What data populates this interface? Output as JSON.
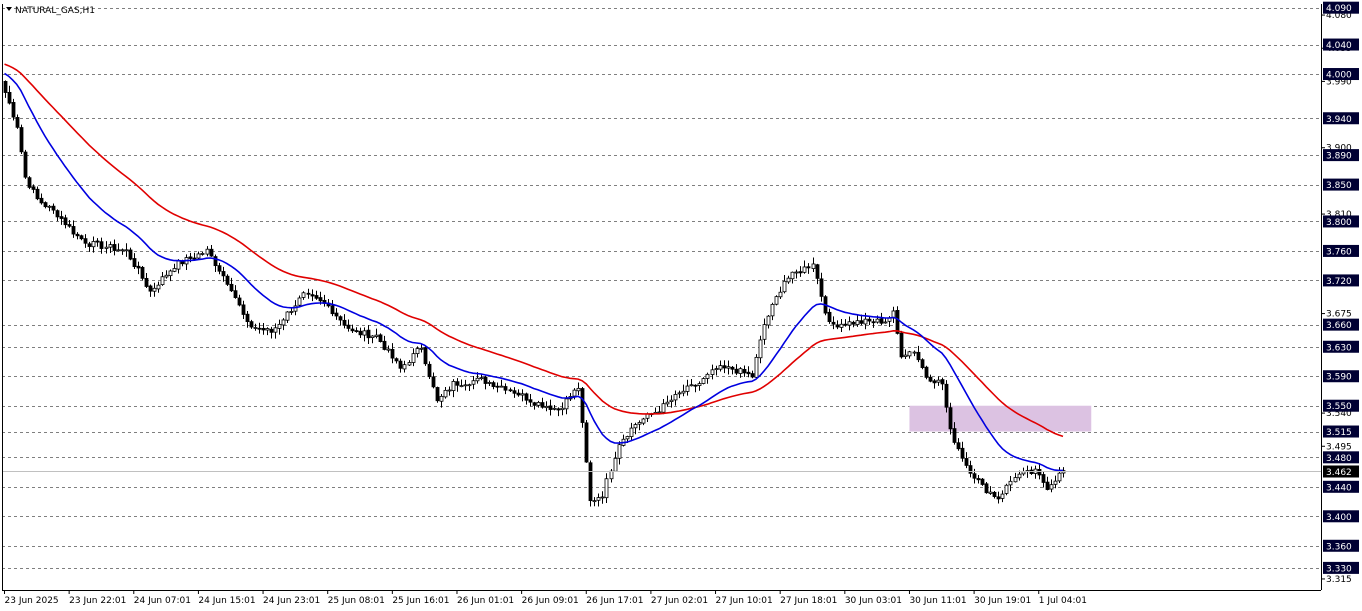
{
  "symbol_label": "NATURAL_GAS,H1",
  "current_price": "3.462",
  "colors": {
    "up": "#ffffff",
    "down": "#000000",
    "ema_fast": "#0000e0",
    "ema_slow": "#e00000",
    "zone": "#dcc2e2",
    "label_bg": "#000033"
  },
  "chart_data": {
    "type": "candlestick",
    "timeframe": "H1",
    "ylim": [
      3.3,
      4.095
    ],
    "y_label_levels": [
      4.09,
      4.04,
      4.0,
      3.94,
      3.89,
      3.85,
      3.8,
      3.76,
      3.72,
      3.66,
      3.63,
      3.59,
      3.55,
      3.515,
      3.48,
      3.44,
      3.4,
      3.36,
      3.33
    ],
    "y_minor_ticks": [
      4.08,
      4.035,
      3.99,
      3.9,
      3.81,
      3.675,
      3.54,
      3.495,
      3.315
    ],
    "x_ticks": [
      {
        "label": "23 Jun 2025",
        "bar": 0
      },
      {
        "label": "23 Jun 22:01",
        "bar": 16
      },
      {
        "label": "24 Jun 07:01",
        "bar": 32
      },
      {
        "label": "24 Jun 15:01",
        "bar": 48
      },
      {
        "label": "24 Jun 23:01",
        "bar": 64
      },
      {
        "label": "25 Jun 08:01",
        "bar": 80
      },
      {
        "label": "25 Jun 16:01",
        "bar": 96
      },
      {
        "label": "26 Jun 01:01",
        "bar": 112
      },
      {
        "label": "26 Jun 09:01",
        "bar": 128
      },
      {
        "label": "26 Jun 17:01",
        "bar": 144
      },
      {
        "label": "27 Jun 02:01",
        "bar": 160
      },
      {
        "label": "27 Jun 10:01",
        "bar": 176
      },
      {
        "label": "27 Jun 18:01",
        "bar": 192
      },
      {
        "label": "30 Jun 03:01",
        "bar": 208
      },
      {
        "label": "30 Jun 11:01",
        "bar": 224
      },
      {
        "label": "30 Jun 19:01",
        "bar": 240
      },
      {
        "label": "1 Jul 04:01",
        "bar": 256
      }
    ],
    "anchors": [
      [
        0,
        3.975
      ],
      [
        3,
        3.93
      ],
      [
        5,
        3.86
      ],
      [
        8,
        3.83
      ],
      [
        13,
        3.81
      ],
      [
        18,
        3.78
      ],
      [
        21,
        3.77
      ],
      [
        30,
        3.76
      ],
      [
        36,
        3.705
      ],
      [
        42,
        3.74
      ],
      [
        50,
        3.76
      ],
      [
        56,
        3.71
      ],
      [
        60,
        3.66
      ],
      [
        66,
        3.65
      ],
      [
        74,
        3.7
      ],
      [
        80,
        3.685
      ],
      [
        86,
        3.65
      ],
      [
        92,
        3.645
      ],
      [
        98,
        3.6
      ],
      [
        103,
        3.63
      ],
      [
        107,
        3.555
      ],
      [
        111,
        3.58
      ],
      [
        118,
        3.585
      ],
      [
        124,
        3.575
      ],
      [
        131,
        3.555
      ],
      [
        137,
        3.545
      ],
      [
        142,
        3.575
      ],
      [
        145,
        3.42
      ],
      [
        148,
        3.43
      ],
      [
        152,
        3.5
      ],
      [
        156,
        3.525
      ],
      [
        162,
        3.545
      ],
      [
        168,
        3.57
      ],
      [
        172,
        3.58
      ],
      [
        176,
        3.6
      ],
      [
        180,
        3.6
      ],
      [
        185,
        3.59
      ],
      [
        188,
        3.66
      ],
      [
        193,
        3.72
      ],
      [
        199,
        3.74
      ],
      [
        200,
        3.745
      ],
      [
        202,
        3.7
      ],
      [
        204,
        3.66
      ],
      [
        210,
        3.663
      ],
      [
        218,
        3.665
      ],
      [
        220,
        3.675
      ],
      [
        222,
        3.62
      ],
      [
        225,
        3.625
      ],
      [
        228,
        3.59
      ],
      [
        232,
        3.58
      ],
      [
        234,
        3.515
      ],
      [
        238,
        3.47
      ],
      [
        242,
        3.44
      ],
      [
        246,
        3.425
      ],
      [
        250,
        3.455
      ],
      [
        255,
        3.46
      ],
      [
        258,
        3.44
      ],
      [
        262,
        3.462
      ]
    ],
    "volatility": 0.009,
    "ema_fast_period": 21,
    "ema_slow_period": 50,
    "supply_zone": {
      "price_top": 3.55,
      "price_bottom": 3.515,
      "bar_start": 224,
      "bar_end": 269
    }
  }
}
